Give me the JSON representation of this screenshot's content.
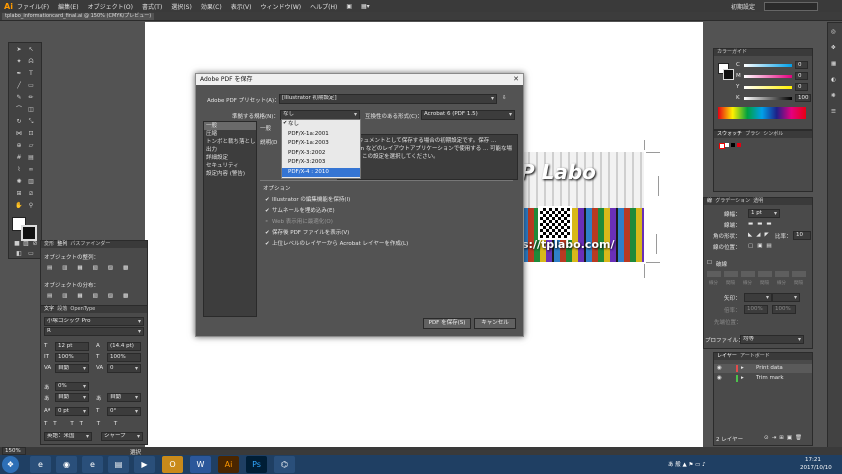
{
  "app": {
    "logo": "Ai",
    "menus": [
      "ファイル(F)",
      "編集(E)",
      "オブジェクト(O)",
      "書式(T)",
      "選択(S)",
      "効果(C)",
      "表示(V)",
      "ウィンドウ(W)",
      "ヘルプ(H)"
    ],
    "workspace": "初期設定"
  },
  "document": {
    "tab_title": "tplabo_informationcard_final.ai @ 150% (CMYK/プレビュー)",
    "zoom": "150%"
  },
  "card": {
    "title": "P Labo",
    "url": "s://tplabo.com/"
  },
  "dialog": {
    "title": "Adobe PDF を保存",
    "preset_label": "Adobe PDF プリセット(A)：",
    "preset_value": "[Illustrator 初期設定]",
    "standard_label": "準拠する規格(N)：",
    "standard_value": "なし",
    "compat_label": "互換性のある形式(C)：",
    "compat_value": "Acrobat 6 (PDF 1.5)",
    "section_general": "一般",
    "desc_label": "説明(D",
    "description": "PDF ドキュメントとして保存する場合の初期設定です。保存 ... InDesign などのレイアウトアプリケーションで使用する ... 可能な場合には、この設定を選択してください。",
    "sidebar": [
      "一般",
      "圧縮",
      "トンボと裁ち落とし",
      "出力",
      "詳細設定",
      "セキュリティ",
      "設定内容 (警告)"
    ],
    "standard_options": [
      "なし",
      "PDF/X-1a:2001",
      "PDF/X-1a:2003",
      "PDF/X-3:2002",
      "PDF/X-3:2003",
      "PDF/X-4 : 2010"
    ],
    "options_title": "オプション",
    "options": [
      {
        "label": "Illustrator の編集機能を保持(I)",
        "checked": true
      },
      {
        "label": "サムネールを埋め込み(E)",
        "checked": true
      },
      {
        "label": "Web 表示用に最適化(O)",
        "checked": false
      },
      {
        "label": "保存後 PDF ファイルを表示(V)",
        "checked": true
      },
      {
        "label": "上位レベルのレイヤーから Acrobat レイヤーを作成(L)",
        "checked": true
      }
    ],
    "save_button": "PDF を保存(S)",
    "cancel_button": "キャンセル"
  },
  "panels": {
    "color": {
      "tabs": [
        "カラーガイド"
      ],
      "labels": [
        "C",
        "M",
        "Y",
        "K"
      ],
      "values": [
        "0",
        "0",
        "0",
        "100"
      ],
      "units": "%"
    },
    "swatches": {
      "tabs": [
        "スウォッチ",
        "ブラシ",
        "シンボル"
      ]
    },
    "stroke": {
      "tabs": [
        "線",
        "グラデーション",
        "透明"
      ],
      "weight_label": "線幅：",
      "weight_value": "1 pt",
      "cap_label": "線端：",
      "corner_label": "角の形状：",
      "limit_label": "比率：",
      "limit_value": "10",
      "align_label": "線の位置：",
      "dashed_label": "破線",
      "dash_fields": [
        "線分",
        "間隔",
        "線分",
        "間隔",
        "線分",
        "間隔"
      ],
      "arrow_label": "矢印：",
      "scale_label": "倍率：",
      "scale_values": [
        "100%",
        "100%"
      ],
      "position_label": "先端位置：",
      "profile_label": "プロファイル：",
      "profile_value": "均等"
    },
    "layers": {
      "tabs": [
        "レイヤー",
        "アートボード"
      ],
      "rows": [
        {
          "name": "Print data"
        },
        {
          "name": "Trim mark"
        }
      ],
      "footer": "2 レイヤー"
    },
    "align": {
      "tabs": [
        "変形",
        "整列",
        "パスファインダー"
      ],
      "align_objects": "オブジェクトの整列：",
      "distribute_objects": "オブジェクトの分布："
    },
    "type": {
      "tabs": [
        "文字",
        "段落",
        "OpenType"
      ],
      "font": "小塚ゴシック Pro",
      "style": "R",
      "size": "12 pt",
      "leading": "(14.4 pt)",
      "vscale": "100%",
      "hscale": "100%",
      "kerning": "自動",
      "tracking": "0",
      "tsume": "0%",
      "aki1": "自動",
      "aki2": "自動",
      "baseline": "0 pt",
      "rotate": "0°",
      "lang": "英語：米国",
      "aa": "シャープ"
    }
  },
  "taskbar": {
    "clock_time": "17:21",
    "clock_date": "2017/10/10",
    "status_text": "選択"
  }
}
